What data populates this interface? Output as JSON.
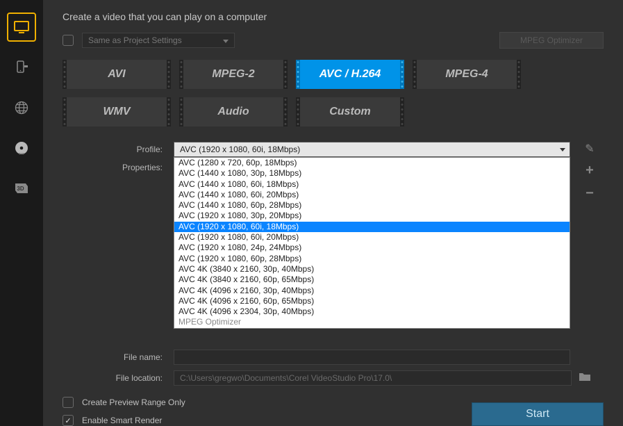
{
  "heading": "Create a video that you can play on a computer",
  "same_as_project_label": "Same as Project Settings",
  "mpeg_optimizer_btn": "MPEG Optimizer",
  "formats": [
    "AVI",
    "MPEG-2",
    "AVC / H.264",
    "MPEG-4",
    "WMV",
    "Audio",
    "Custom"
  ],
  "format_active_index": 2,
  "labels": {
    "profile": "Profile:",
    "properties": "Properties:",
    "file_name": "File name:",
    "file_location": "File location:"
  },
  "profile_selected": "AVC (1920 x 1080, 60i, 18Mbps)",
  "profile_options": [
    "AVC (1280 x 720, 60p, 18Mbps)",
    "AVC (1440 x 1080, 30p, 18Mbps)",
    "AVC (1440 x 1080, 60i, 18Mbps)",
    "AVC (1440 x 1080, 60i, 20Mbps)",
    "AVC (1440 x 1080, 60p, 28Mbps)",
    "AVC (1920 x 1080, 30p, 20Mbps)",
    "AVC (1920 x 1080, 60i, 18Mbps)",
    "AVC (1920 x 1080, 60i, 20Mbps)",
    "AVC (1920 x 1080, 24p, 24Mbps)",
    "AVC (1920 x 1080, 60p, 28Mbps)",
    "AVC 4K (3840 x 2160, 30p, 40Mbps)",
    "AVC 4K (3840 x 2160, 60p, 65Mbps)",
    "AVC 4K (4096 x 2160, 30p, 40Mbps)",
    "AVC 4K (4096 x 2160, 60p, 65Mbps)",
    "AVC 4K (4096 x 2304, 30p, 40Mbps)",
    "MPEG Optimizer"
  ],
  "profile_highlight_index": 6,
  "file_name_value": "",
  "file_location_value": "C:\\Users\\gregwo\\Documents\\Corel VideoStudio Pro\\17.0\\",
  "create_preview_label": "Create Preview Range Only",
  "create_preview_checked": false,
  "smart_render_label": "Enable Smart Render",
  "smart_render_checked": true,
  "start_button": "Start"
}
